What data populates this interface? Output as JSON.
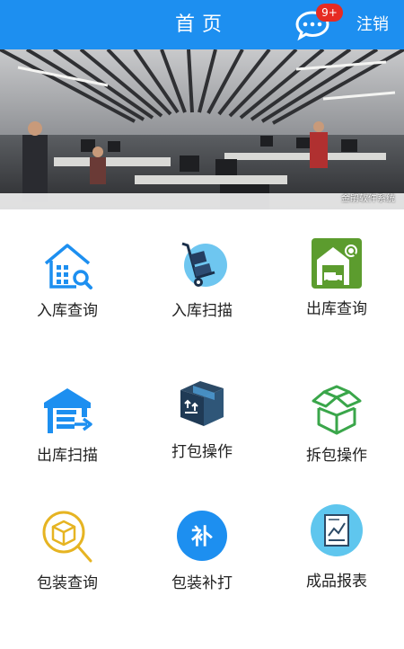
{
  "header": {
    "title": "首页",
    "badge_count": "9+",
    "logout_label": "注销",
    "bar_color": "#1d8ff0"
  },
  "banner": {
    "caption": "金鹃软件系统",
    "image": "office-photo"
  },
  "menu": [
    {
      "label": "入库查询",
      "icon": "warehouse-search-icon"
    },
    {
      "label": "入库扫描",
      "icon": "hand-truck-icon"
    },
    {
      "label": "出库查询",
      "icon": "garage-search-icon"
    },
    {
      "label": "出库扫描",
      "icon": "warehouse-exit-icon"
    },
    {
      "label": "打包操作",
      "icon": "package-box-icon"
    },
    {
      "label": "拆包操作",
      "icon": "open-boxes-icon"
    },
    {
      "label": "包装查询",
      "icon": "box-search-icon"
    },
    {
      "label": "包装补打",
      "icon": "reprint-icon"
    },
    {
      "label": "成品报表",
      "icon": "report-chart-icon"
    }
  ]
}
